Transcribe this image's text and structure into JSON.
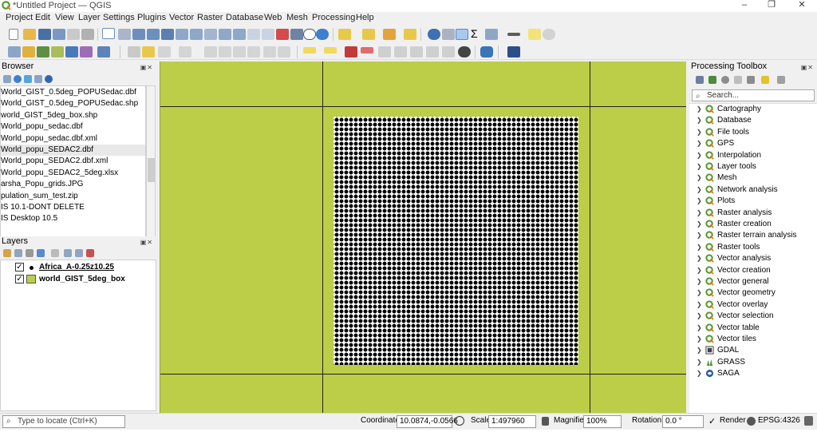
{
  "window": {
    "title": "*Untitled Project — QGIS",
    "controls": [
      "–",
      "❐",
      "✕"
    ]
  },
  "menu": [
    "Project",
    "Edit",
    "View",
    "Layer",
    "Settings",
    "Plugins",
    "Vector",
    "Raster",
    "Database",
    "Web",
    "Mesh",
    "Processing",
    "Help"
  ],
  "browser": {
    "title": "Browser",
    "items": [
      "World_GIST_0.5deg_POPUSedac.dbf",
      "World_GIST_0.5deg_POPUSedac.shp",
      "world_GIST_5deg_box.shp",
      "World_popu_sedac.dbf",
      "World_popu_sedac.dbf.xml",
      "World_popu_SEDAC2.dbf",
      "World_popu_SEDAC2.dbf.xml",
      "World_popu_SEDAC2_5deg.xlsx",
      "arsha_Popu_grids.JPG",
      "pulation_sum_test.zip",
      "IS 10.1-DONT DELETE",
      "IS Desktop 10.5"
    ],
    "selected_index": 5
  },
  "layers": {
    "title": "Layers",
    "items": [
      {
        "name": "Africa_A-0.25z10.25",
        "checked": true,
        "symbol": "point"
      },
      {
        "name": "world_GIST_5deg_box",
        "checked": true,
        "symbol": "polygon"
      }
    ]
  },
  "toolbox": {
    "title": "Processing Toolbox",
    "search_placeholder": "Search...",
    "providers": [
      {
        "label": "Cartography",
        "icon": "qgis-icon"
      },
      {
        "label": "Database",
        "icon": "qgis-icon"
      },
      {
        "label": "File tools",
        "icon": "qgis-icon"
      },
      {
        "label": "GPS",
        "icon": "qgis-icon"
      },
      {
        "label": "Interpolation",
        "icon": "qgis-icon"
      },
      {
        "label": "Layer tools",
        "icon": "qgis-icon"
      },
      {
        "label": "Mesh",
        "icon": "qgis-icon"
      },
      {
        "label": "Network analysis",
        "icon": "qgis-icon"
      },
      {
        "label": "Plots",
        "icon": "qgis-icon"
      },
      {
        "label": "Raster analysis",
        "icon": "qgis-icon"
      },
      {
        "label": "Raster creation",
        "icon": "qgis-icon"
      },
      {
        "label": "Raster terrain analysis",
        "icon": "qgis-icon"
      },
      {
        "label": "Raster tools",
        "icon": "qgis-icon"
      },
      {
        "label": "Vector analysis",
        "icon": "qgis-icon"
      },
      {
        "label": "Vector creation",
        "icon": "qgis-icon"
      },
      {
        "label": "Vector general",
        "icon": "qgis-icon"
      },
      {
        "label": "Vector geometry",
        "icon": "qgis-icon"
      },
      {
        "label": "Vector overlay",
        "icon": "qgis-icon"
      },
      {
        "label": "Vector selection",
        "icon": "qgis-icon"
      },
      {
        "label": "Vector table",
        "icon": "qgis-icon"
      },
      {
        "label": "Vector tiles",
        "icon": "qgis-icon"
      },
      {
        "label": "GDAL",
        "icon": "gdal-icon"
      },
      {
        "label": "GRASS",
        "icon": "grass-icon"
      },
      {
        "label": "SAGA",
        "icon": "saga-icon"
      }
    ]
  },
  "statusbar": {
    "locate_placeholder": "Type to locate (Ctrl+K)",
    "coordinate_label": "Coordinate",
    "coordinate_value": "10.0874,-0.0566",
    "scale_label": "Scale",
    "scale_value": "1:497960",
    "magnifier_label": "Magnifier",
    "magnifier_value": "100%",
    "rotation_label": "Rotation",
    "rotation_value": "0.0 °",
    "render_label": "Render",
    "crs_label": "EPSG:4326"
  },
  "colors": {
    "canvas_fill": "#bccd48",
    "qgis_green": "#589632",
    "layer_polygon": "#bccd48"
  }
}
